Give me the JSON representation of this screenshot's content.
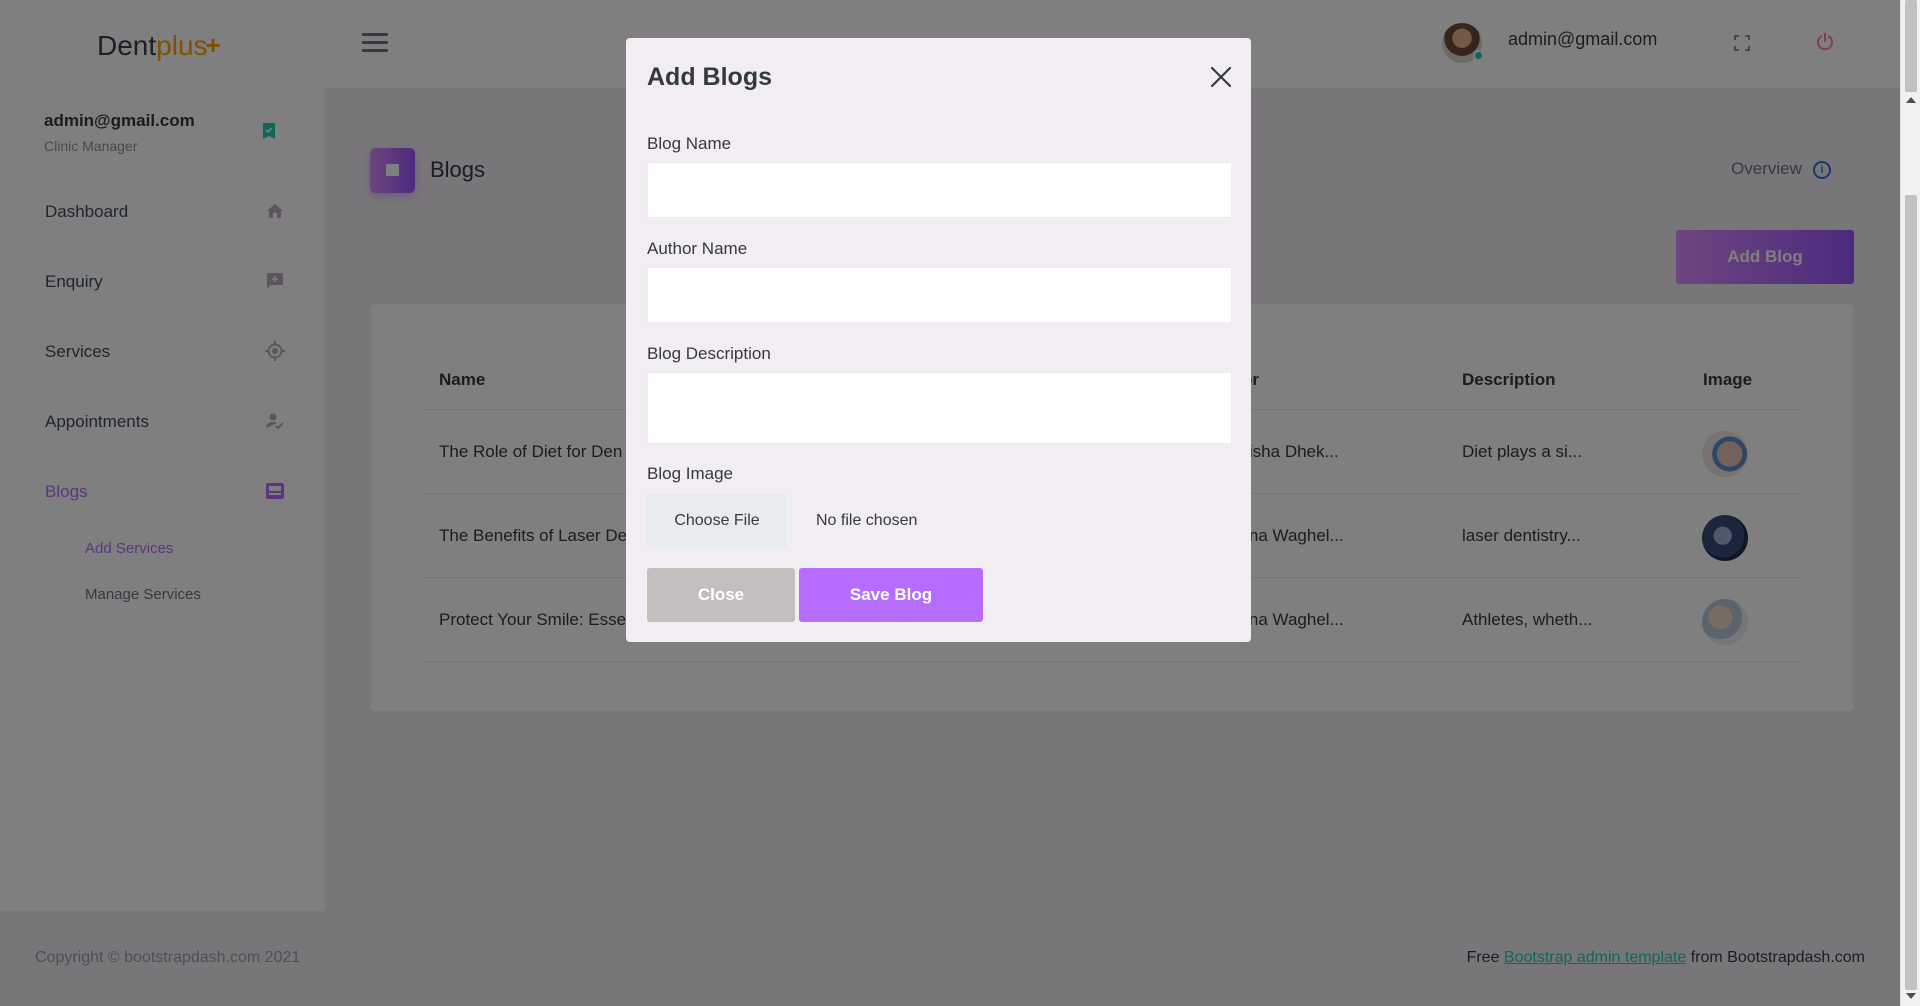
{
  "navbar": {
    "brand_main": "Dent",
    "brand_accent": "plus",
    "brand_plus": "+",
    "user_email": "admin@gmail.com"
  },
  "sidebar": {
    "profile_name": "admin@gmail.com",
    "profile_role": "Clinic Manager",
    "items": [
      {
        "label": "Dashboard",
        "icon": "home-icon"
      },
      {
        "label": "Enquiry",
        "icon": "chat-icon"
      },
      {
        "label": "Services",
        "icon": "crosshair-icon"
      },
      {
        "label": "Appointments",
        "icon": "user-check-icon"
      },
      {
        "label": "Blogs",
        "icon": "blog-icon",
        "active": true
      }
    ],
    "sub_items": [
      {
        "label": "Add Services",
        "active": true
      },
      {
        "label": "Manage Services"
      }
    ]
  },
  "page": {
    "title": "Blogs",
    "overview_label": "Overview",
    "add_blog_label": "Add Blog"
  },
  "table": {
    "headers": [
      "Name",
      "or",
      "Description",
      "Image"
    ],
    "rows": [
      {
        "name": "The Role of Diet for Den",
        "author": "anisha Dhek...",
        "description": "Diet plays a si..."
      },
      {
        "name": "The Benefits of Laser De",
        "author": "eena Waghel...",
        "description": "laser dentistry..."
      },
      {
        "name": "Protect Your Smile: Esse",
        "author": "eena Waghel...",
        "description": "Athletes, wheth..."
      }
    ]
  },
  "footer": {
    "copyright": "Copyright © bootstrapdash.com 2021",
    "free_text": "Free ",
    "link_text": "Bootstrap admin template",
    "from_text": " from Bootstrapdash.com"
  },
  "modal": {
    "title": "Add Blogs",
    "blog_name_label": "Blog Name",
    "blog_name_value": "",
    "author_name_label": "Author Name",
    "author_name_value": "",
    "description_label": "Blog Description",
    "description_value": "",
    "image_label": "Blog Image",
    "choose_file_label": "Choose File",
    "file_status": "No file chosen",
    "close_label": "Close",
    "save_label": "Save Blog"
  },
  "colors": {
    "accent": "#b66dff",
    "accent_gradient_start": "#da8cff",
    "accent_gradient_end": "#9a55ff",
    "footer_link": "#1bcfb4",
    "power": "#fe7c96"
  }
}
